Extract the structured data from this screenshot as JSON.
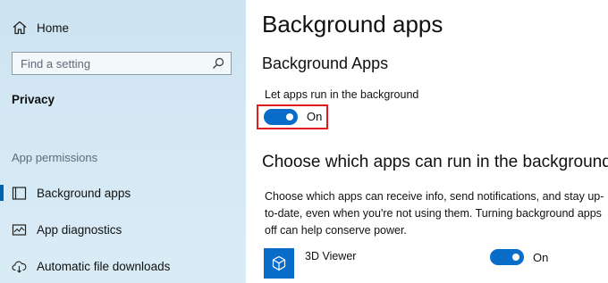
{
  "sidebar": {
    "home": {
      "label": "Home",
      "icon": "home-icon"
    },
    "search": {
      "placeholder": "Find a setting",
      "icon": "search-icon"
    },
    "category": "Privacy",
    "section_heading": "App permissions",
    "items": [
      {
        "label": "Background apps",
        "icon": "background-apps-icon",
        "selected": true
      },
      {
        "label": "App diagnostics",
        "icon": "app-diagnostics-icon",
        "selected": false
      },
      {
        "label": "Automatic file downloads",
        "icon": "cloud-download-icon",
        "selected": false
      }
    ]
  },
  "main": {
    "title": "Background apps",
    "background_apps": {
      "heading": "Background Apps",
      "toggle_label": "Let apps run in the background",
      "toggle_state": "On",
      "toggle_on": true
    },
    "choose": {
      "heading": "Choose which apps can run in the background",
      "description": "Choose which apps can receive info, send notifications, and stay up-to-date, even when you're not using them. Turning background apps off can help conserve power."
    },
    "apps": [
      {
        "name": "3D Viewer",
        "icon": "3d-cube-icon",
        "state": "On",
        "on": true
      }
    ]
  },
  "colors": {
    "accent": "#0a6cc9",
    "highlight_border": "#e31b1b",
    "sidebar_bg": "#d4e8f4"
  }
}
